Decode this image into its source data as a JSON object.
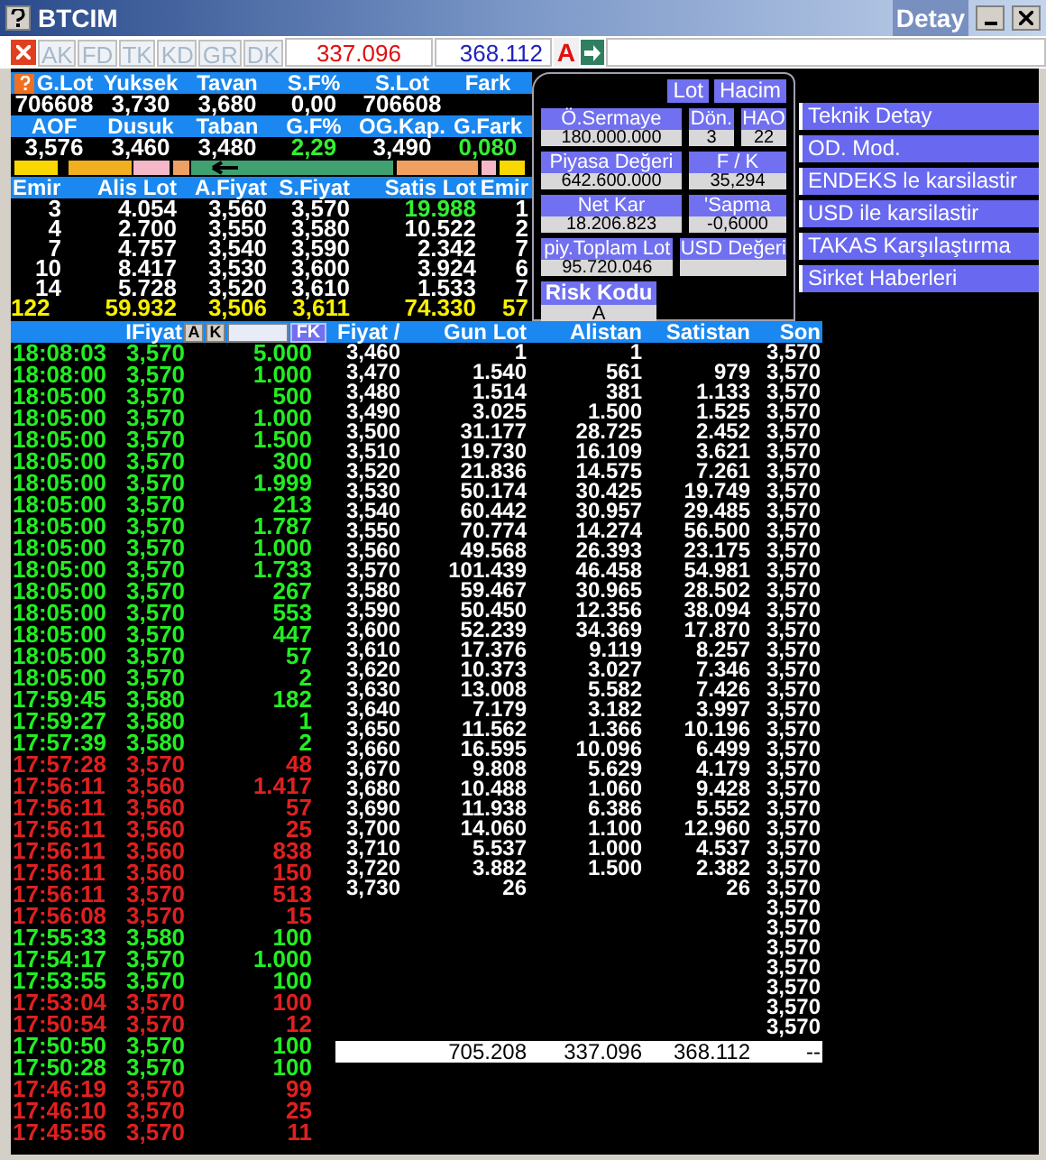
{
  "window": {
    "title": "BTCIM",
    "subtitle": "Detay"
  },
  "toolbar": {
    "buttons": [
      {
        "label": "AK",
        "disabled": true
      },
      {
        "label": "FD",
        "disabled": true
      },
      {
        "label": "TK",
        "disabled": true
      },
      {
        "label": "KD",
        "disabled": true
      },
      {
        "label": "GR",
        "disabled": true
      },
      {
        "label": "DK",
        "disabled": true
      }
    ],
    "sell_total": "337.096",
    "buy_total": "368.112",
    "flag": "A"
  },
  "stats": [
    {
      "cells": [
        {
          "label": "G.Lot",
          "value": "706608"
        },
        {
          "label": "Yuksek",
          "value": "3,730"
        },
        {
          "label": "Tavan",
          "value": "3,680"
        },
        {
          "label": "S.F%",
          "value": "0,00"
        },
        {
          "label": "S.Lot",
          "value": "706608"
        },
        {
          "label": "Fark"
        }
      ]
    },
    {
      "cells": [
        {
          "label": "AOF",
          "value": "3,576"
        },
        {
          "label": "Dusuk",
          "value": "3,460"
        },
        {
          "label": "Taban",
          "value": "3,480"
        },
        {
          "label": "G.F%",
          "value": "2,29",
          "color": "#33ee33"
        },
        {
          "label": "OG.Kap.",
          "value": "3,490"
        },
        {
          "label": "G.Fark",
          "value": "0,080",
          "color": "#33ee33"
        }
      ]
    }
  ],
  "order_book": {
    "columns": [
      "Emir",
      "Alis Lot",
      "A.Fiyat",
      "S.Fiyat",
      "Satis Lot",
      "Emir"
    ],
    "rows": [
      {
        "cells": [
          "3",
          "4.054",
          "3,560",
          "3,570",
          {
            "text": "19.988",
            "color": "#33ee33"
          },
          "1"
        ]
      },
      {
        "cells": [
          "4",
          "2.700",
          "3,550",
          "3,580",
          "10.522",
          "2"
        ]
      },
      {
        "cells": [
          "7",
          "4.757",
          "3,540",
          "3,590",
          "2.342",
          "7"
        ]
      },
      {
        "cells": [
          "10",
          "8.417",
          "3,530",
          "3,600",
          "3.924",
          "6"
        ]
      },
      {
        "cells": [
          "14",
          "5.728",
          "3,520",
          "3,610",
          "1.533",
          "7"
        ]
      }
    ],
    "totals": [
      "122",
      "59.932",
      "3,506",
      "3,611",
      "74.330",
      "57"
    ]
  },
  "info_panel": {
    "toggles": [
      "Lot",
      "Hacim"
    ],
    "rows": [
      [
        {
          "label": "Ö.Sermaye",
          "value": "180.000.000"
        },
        {
          "label": "Dön.",
          "value": "3"
        },
        {
          "label": "HAO",
          "value": "22"
        }
      ],
      [
        {
          "label": "Piyasa Değeri",
          "value": "642.600.000"
        },
        {
          "label": "F / K",
          "value": "35,294"
        }
      ],
      [
        {
          "label": "Net Kar",
          "value": "18.206.823"
        },
        {
          "label": "'Sapma",
          "value": "-0,6000"
        }
      ],
      [
        {
          "label": "piy.Toplam Lot",
          "value": "95.720.046"
        },
        {
          "label": "USD Değeri"
        }
      ]
    ],
    "risk": {
      "label": "Risk Kodu",
      "value": "A"
    }
  },
  "menu": [
    "Teknik Detay",
    "OD. Mod.",
    "ENDEKS le karsilastir",
    "USD ile karsilastir",
    "TAKAS Karşılaştırma",
    "Sirket Haberleri"
  ],
  "trades": {
    "header": "IFiyat",
    "buttons": [
      "A",
      "K"
    ],
    "filter_button": "FK",
    "rows": [
      {
        "time": "18:08:03",
        "price": "3,570",
        "lot": "5.000",
        "color": "#22ee22"
      },
      {
        "time": "18:08:00",
        "price": "3,570",
        "lot": "1.000",
        "color": "#22ee22"
      },
      {
        "time": "18:05:00",
        "price": "3,570",
        "lot": "500",
        "color": "#22ee22"
      },
      {
        "time": "18:05:00",
        "price": "3,570",
        "lot": "1.000",
        "color": "#22ee22"
      },
      {
        "time": "18:05:00",
        "price": "3,570",
        "lot": "1.500",
        "color": "#22ee22"
      },
      {
        "time": "18:05:00",
        "price": "3,570",
        "lot": "300",
        "color": "#22ee22"
      },
      {
        "time": "18:05:00",
        "price": "3,570",
        "lot": "1.999",
        "color": "#22ee22"
      },
      {
        "time": "18:05:00",
        "price": "3,570",
        "lot": "213",
        "color": "#22ee22"
      },
      {
        "time": "18:05:00",
        "price": "3,570",
        "lot": "1.787",
        "color": "#22ee22"
      },
      {
        "time": "18:05:00",
        "price": "3,570",
        "lot": "1.000",
        "color": "#22ee22"
      },
      {
        "time": "18:05:00",
        "price": "3,570",
        "lot": "1.733",
        "color": "#22ee22"
      },
      {
        "time": "18:05:00",
        "price": "3,570",
        "lot": "267",
        "color": "#22ee22"
      },
      {
        "time": "18:05:00",
        "price": "3,570",
        "lot": "553",
        "color": "#22ee22"
      },
      {
        "time": "18:05:00",
        "price": "3,570",
        "lot": "447",
        "color": "#22ee22"
      },
      {
        "time": "18:05:00",
        "price": "3,570",
        "lot": "57",
        "color": "#22ee22"
      },
      {
        "time": "18:05:00",
        "price": "3,570",
        "lot": "2",
        "color": "#22ee22"
      },
      {
        "time": "17:59:45",
        "price": "3,580",
        "lot": "182",
        "color": "#22ee22"
      },
      {
        "time": "17:59:27",
        "price": "3,580",
        "lot": "1",
        "color": "#22ee22"
      },
      {
        "time": "17:57:39",
        "price": "3,580",
        "lot": "2",
        "color": "#22ee22"
      },
      {
        "time": "17:57:28",
        "price": "3,570",
        "lot": "48",
        "color": "#e02020"
      },
      {
        "time": "17:56:11",
        "price": "3,560",
        "lot": "1.417",
        "color": "#e02020"
      },
      {
        "time": "17:56:11",
        "price": "3,560",
        "lot": "57",
        "color": "#e02020"
      },
      {
        "time": "17:56:11",
        "price": "3,560",
        "lot": "25",
        "color": "#e02020"
      },
      {
        "time": "17:56:11",
        "price": "3,560",
        "lot": "838",
        "color": "#e02020"
      },
      {
        "time": "17:56:11",
        "price": "3,560",
        "lot": "150",
        "color": "#e02020"
      },
      {
        "time": "17:56:11",
        "price": "3,570",
        "lot": "513",
        "color": "#e02020"
      },
      {
        "time": "17:56:08",
        "price": "3,570",
        "lot": "15",
        "color": "#e02020"
      },
      {
        "time": "17:55:33",
        "price": "3,580",
        "lot": "100",
        "color": "#22ee22"
      },
      {
        "time": "17:54:17",
        "price": "3,570",
        "lot": "1.000",
        "color": "#22ee22"
      },
      {
        "time": "17:53:55",
        "price": "3,570",
        "lot": "100",
        "color": "#22ee22"
      },
      {
        "time": "17:53:04",
        "price": "3,570",
        "lot": "100",
        "color": "#e02020"
      },
      {
        "time": "17:50:54",
        "price": "3,570",
        "lot": "12",
        "color": "#e02020"
      },
      {
        "time": "17:50:50",
        "price": "3,570",
        "lot": "100",
        "color": "#22ee22"
      },
      {
        "time": "17:50:28",
        "price": "3,570",
        "lot": "100",
        "color": "#22ee22"
      },
      {
        "time": "17:46:19",
        "price": "3,570",
        "lot": "99",
        "color": "#e02020"
      },
      {
        "time": "17:46:10",
        "price": "3,570",
        "lot": "25",
        "color": "#e02020"
      },
      {
        "time": "17:45:56",
        "price": "3,570",
        "lot": "11",
        "color": "#e02020"
      }
    ]
  },
  "depth": {
    "columns": [
      "Fiyat /",
      "Gun Lot",
      "Alistan",
      "Satistan",
      "Son"
    ],
    "rows": [
      {
        "fiyat": "3,460",
        "gun_lot": "1",
        "alistan": "1",
        "son": "3,570"
      },
      {
        "fiyat": "3,470",
        "gun_lot": "1.540",
        "alistan": "561",
        "satistan": "979",
        "son": "3,570"
      },
      {
        "fiyat": "3,480",
        "gun_lot": "1.514",
        "alistan": "381",
        "satistan": "1.133",
        "son": "3,570"
      },
      {
        "fiyat": "3,490",
        "gun_lot": "3.025",
        "alistan": "1.500",
        "satistan": "1.525",
        "son": "3,570"
      },
      {
        "fiyat": "3,500",
        "gun_lot": "31.177",
        "alistan": "28.725",
        "satistan": "2.452",
        "son": "3,570"
      },
      {
        "fiyat": "3,510",
        "gun_lot": "19.730",
        "alistan": "16.109",
        "satistan": "3.621",
        "son": "3,570"
      },
      {
        "fiyat": "3,520",
        "gun_lot": "21.836",
        "alistan": "14.575",
        "satistan": "7.261",
        "son": "3,570"
      },
      {
        "fiyat": "3,530",
        "gun_lot": "50.174",
        "alistan": "30.425",
        "satistan": "19.749",
        "son": "3,570"
      },
      {
        "fiyat": "3,540",
        "gun_lot": "60.442",
        "alistan": "30.957",
        "satistan": "29.485",
        "son": "3,570"
      },
      {
        "fiyat": "3,550",
        "gun_lot": "70.774",
        "alistan": "14.274",
        "satistan": "56.500",
        "son": "3,570"
      },
      {
        "fiyat": "3,560",
        "gun_lot": "49.568",
        "alistan": "26.393",
        "satistan": "23.175",
        "son": "3,570"
      },
      {
        "fiyat": "3,570",
        "gun_lot": "101.439",
        "alistan": "46.458",
        "satistan": "54.981",
        "son": "3,570"
      },
      {
        "fiyat": "3,580",
        "gun_lot": "59.467",
        "alistan": "30.965",
        "satistan": "28.502",
        "son": "3,570"
      },
      {
        "fiyat": "3,590",
        "gun_lot": "50.450",
        "alistan": "12.356",
        "satistan": "38.094",
        "son": "3,570"
      },
      {
        "fiyat": "3,600",
        "gun_lot": "52.239",
        "alistan": "34.369",
        "satistan": "17.870",
        "son": "3,570"
      },
      {
        "fiyat": "3,610",
        "gun_lot": "17.376",
        "alistan": "9.119",
        "satistan": "8.257",
        "son": "3,570"
      },
      {
        "fiyat": "3,620",
        "gun_lot": "10.373",
        "alistan": "3.027",
        "satistan": "7.346",
        "son": "3,570"
      },
      {
        "fiyat": "3,630",
        "gun_lot": "13.008",
        "alistan": "5.582",
        "satistan": "7.426",
        "son": "3,570"
      },
      {
        "fiyat": "3,640",
        "gun_lot": "7.179",
        "alistan": "3.182",
        "satistan": "3.997",
        "son": "3,570"
      },
      {
        "fiyat": "3,650",
        "gun_lot": "11.562",
        "alistan": "1.366",
        "satistan": "10.196",
        "son": "3,570"
      },
      {
        "fiyat": "3,660",
        "gun_lot": "16.595",
        "alistan": "10.096",
        "satistan": "6.499",
        "son": "3,570"
      },
      {
        "fiyat": "3,670",
        "gun_lot": "9.808",
        "alistan": "5.629",
        "satistan": "4.179",
        "son": "3,570"
      },
      {
        "fiyat": "3,680",
        "gun_lot": "10.488",
        "alistan": "1.060",
        "satistan": "9.428",
        "son": "3,570"
      },
      {
        "fiyat": "3,690",
        "gun_lot": "11.938",
        "alistan": "6.386",
        "satistan": "5.552",
        "son": "3,570"
      },
      {
        "fiyat": "3,700",
        "gun_lot": "14.060",
        "alistan": "1.100",
        "satistan": "12.960",
        "son": "3,570"
      },
      {
        "fiyat": "3,710",
        "gun_lot": "5.537",
        "alistan": "1.000",
        "satistan": "4.537",
        "son": "3,570"
      },
      {
        "fiyat": "3,720",
        "gun_lot": "3.882",
        "alistan": "1.500",
        "satistan": "2.382",
        "son": "3,570"
      },
      {
        "fiyat": "3,730",
        "gun_lot": "26",
        "satistan": "26",
        "son": "3,570"
      },
      {
        "son": "3,570"
      },
      {
        "son": "3,570"
      },
      {
        "son": "3,570"
      },
      {
        "son": "3,570"
      },
      {
        "son": "3,570"
      },
      {
        "son": "3,570"
      },
      {
        "son": "3,570"
      }
    ],
    "totals": {
      "gun_lot": "705.208",
      "alistan": "337.096",
      "satistan": "368.112",
      "son": "--"
    }
  }
}
